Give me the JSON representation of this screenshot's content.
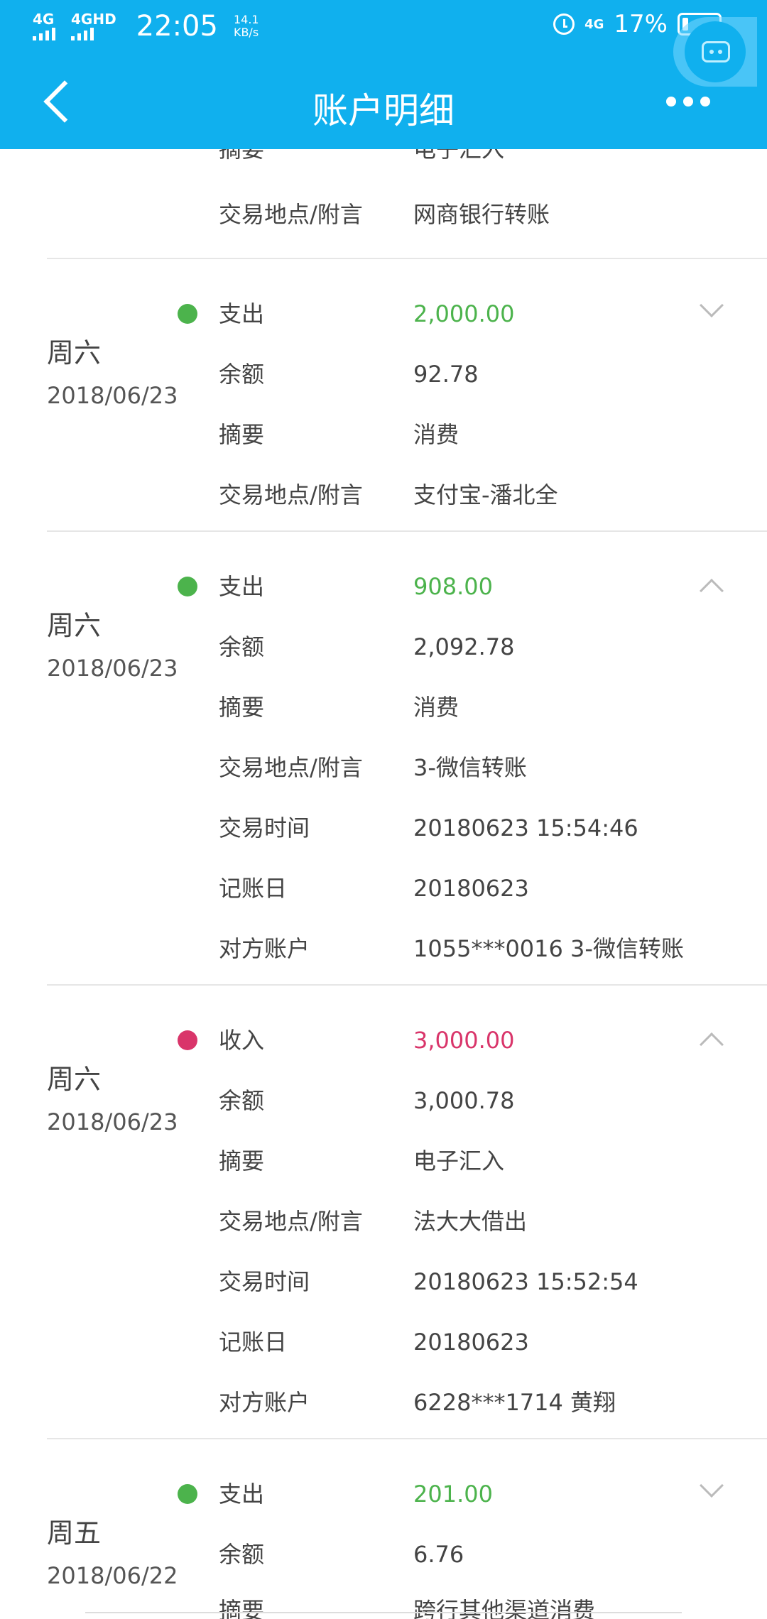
{
  "status_bar": {
    "sig1": "4G",
    "sig2": "4GHD",
    "time": "22:05",
    "speed_value": "14.1",
    "speed_unit": "KB/s",
    "net_right": "4G",
    "battery_pct": "17%"
  },
  "nav": {
    "title": "账户明细",
    "back_icon": "chevron-left-icon",
    "more_icon": "more-dots-icon"
  },
  "colors": {
    "header": "#10b0ee",
    "expense": "#4cb34c",
    "income": "#d9356a"
  },
  "partial_top": [
    {
      "label": "摘要",
      "value": "电子汇入"
    },
    {
      "label": "交易地点/附言",
      "value": "网商银行转账"
    }
  ],
  "records": [
    {
      "day": "周六",
      "date": "2018/06/23",
      "type": "expense",
      "expanded": false,
      "rows": [
        {
          "label": "支出",
          "value": "2,000.00"
        },
        {
          "label": "余额",
          "value": "92.78"
        },
        {
          "label": "摘要",
          "value": "消费"
        },
        {
          "label": "交易地点/附言",
          "value": "支付宝-潘北全"
        }
      ]
    },
    {
      "day": "周六",
      "date": "2018/06/23",
      "type": "expense",
      "expanded": true,
      "rows": [
        {
          "label": "支出",
          "value": "908.00"
        },
        {
          "label": "余额",
          "value": "2,092.78"
        },
        {
          "label": "摘要",
          "value": "消费"
        },
        {
          "label": "交易地点/附言",
          "value": "3-微信转账"
        },
        {
          "label": "交易时间",
          "value": "20180623 15:54:46"
        },
        {
          "label": "记账日",
          "value": "20180623"
        },
        {
          "label": "对方账户",
          "value": "1055***0016 3-微信转账"
        }
      ]
    },
    {
      "day": "周六",
      "date": "2018/06/23",
      "type": "income",
      "expanded": true,
      "rows": [
        {
          "label": "收入",
          "value": "3,000.00"
        },
        {
          "label": "余额",
          "value": "3,000.78"
        },
        {
          "label": "摘要",
          "value": "电子汇入"
        },
        {
          "label": "交易地点/附言",
          "value": "法大大借出"
        },
        {
          "label": "交易时间",
          "value": "20180623 15:52:54"
        },
        {
          "label": "记账日",
          "value": "20180623"
        },
        {
          "label": "对方账户",
          "value": "6228***1714 黄翔"
        }
      ]
    },
    {
      "day": "周五",
      "date": "2018/06/22",
      "type": "expense",
      "expanded": false,
      "rows": [
        {
          "label": "支出",
          "value": "201.00"
        },
        {
          "label": "余额",
          "value": "6.76"
        },
        {
          "label": "摘要",
          "value": "跨行其他渠道消费"
        }
      ]
    }
  ]
}
